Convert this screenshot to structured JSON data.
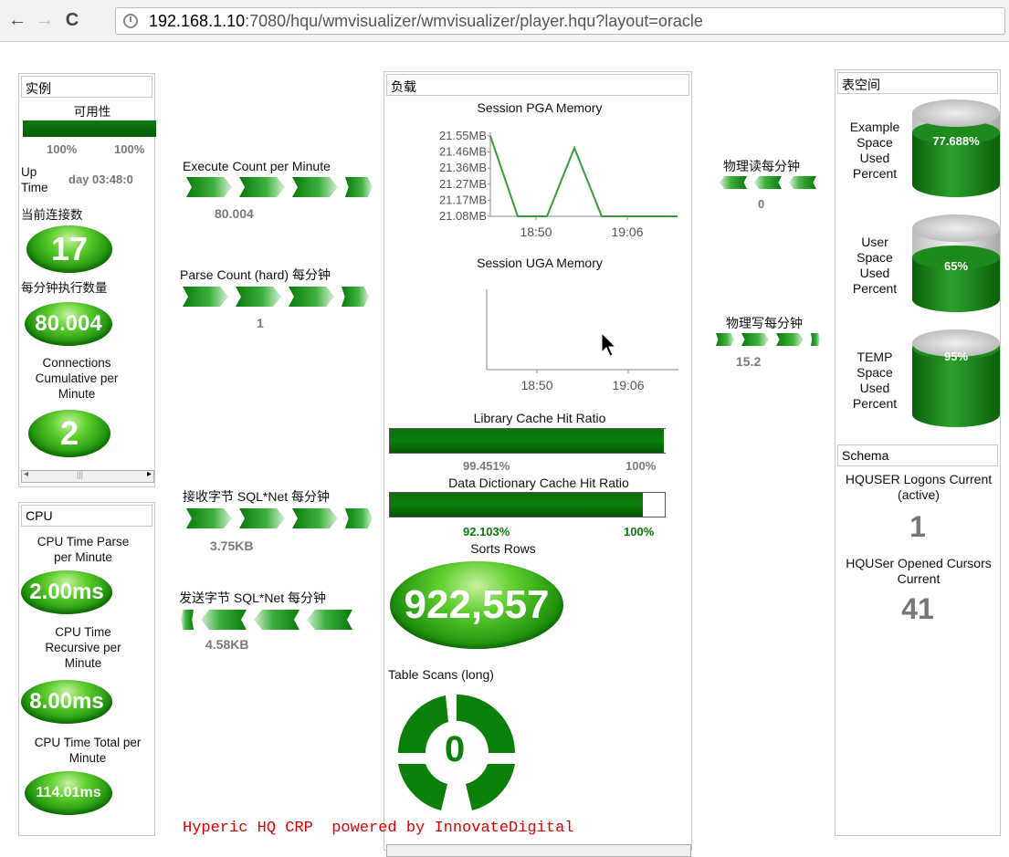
{
  "browser": {
    "url_host": "192.168.1.10",
    "url_rest": ":7080/hqu/wmvisualizer/wmvisualizer/player.hqu?layout=oracle"
  },
  "instance": {
    "title": "实例",
    "availability_label": "可用性",
    "availability_value": "100%",
    "availability_max": "100%",
    "uptime_label": "Up Time",
    "uptime_value": "day 03:48:0",
    "current_conn_label": "当前连接数",
    "current_conn_value": "17",
    "exec_per_min_label": "每分钟执行数量",
    "exec_per_min_value": "80.004",
    "conn_cum_label": "Connections Cumulative per Minute",
    "conn_cum_value": "2"
  },
  "cpu": {
    "title": "CPU",
    "parse_label": "CPU Time Parse per Minute",
    "parse_value": "2.00ms",
    "recursive_label": "CPU Time Recursive per Minute",
    "recursive_value": "8.00ms",
    "total_label": "CPU Time Total per Minute",
    "total_value": "114.01ms"
  },
  "rates": {
    "execute_label": "Execute Count per Minute",
    "execute_value": "80.004",
    "parse_label": "Parse Count (hard) 每分钟",
    "parse_value": "1",
    "recv_label": "接收字节 SQL*Net 每分钟",
    "recv_value": "3.75KB",
    "send_label": "发送字节 SQL*Net 每分钟",
    "send_value": "4.58KB"
  },
  "load": {
    "title": "负载",
    "pga_title": "Session PGA Memory",
    "uga_title": "Session UGA Memory",
    "lib_cache_label": "Library Cache Hit Ratio",
    "lib_cache_value": "99.451%",
    "lib_cache_max": "100%",
    "dict_cache_label": "Data Dictionary Cache Hit Ratio",
    "dict_cache_value": "92.103%",
    "dict_cache_max": "100%",
    "sorts_label": "Sorts Rows",
    "sorts_value": "922,557",
    "scans_label": "Table Scans (long)",
    "scans_value": "0"
  },
  "io": {
    "phys_read_label": "物理读每分钟",
    "phys_read_value": "0",
    "phys_write_label": "物理写每分钟",
    "phys_write_value": "15.2"
  },
  "tablespace": {
    "title": "表空间",
    "items": [
      {
        "label": "Example Space Used Percent",
        "value": "77.688%",
        "fraction": 0.77688
      },
      {
        "label": "User Space Used Percent",
        "value": "65%",
        "fraction": 0.65
      },
      {
        "label": "TEMP Space Used Percent",
        "value": "95%",
        "fraction": 0.95
      }
    ]
  },
  "schema": {
    "title": "Schema",
    "logons_label": "HQUSER Logons Current (active)",
    "logons_value": "1",
    "cursors_label": "HQUSer Opened Cursors Current",
    "cursors_value": "41"
  },
  "footer": {
    "credit": "Hyperic HQ CRP  powered by InnovateDigital"
  },
  "chart_data": [
    {
      "type": "line",
      "title": "Session PGA Memory",
      "yticks": [
        "21.55MB",
        "21.46MB",
        "21.36MB",
        "21.27MB",
        "21.17MB",
        "21.08MB"
      ],
      "xticks": [
        "18:50",
        "19:06"
      ],
      "series": [
        {
          "values": [
            21.55,
            21.08,
            21.08,
            21.48,
            21.08,
            21.08,
            21.08
          ]
        }
      ],
      "ylim": [
        21.08,
        21.55
      ]
    },
    {
      "type": "line",
      "title": "Session UGA Memory",
      "xticks": [
        "18:50",
        "19:06"
      ],
      "series": []
    }
  ]
}
